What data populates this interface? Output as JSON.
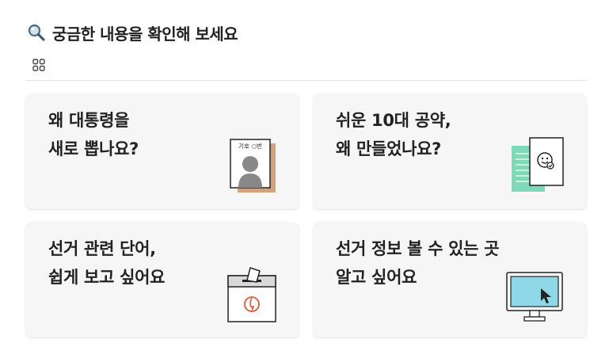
{
  "header": {
    "title": "궁금한 내용을 확인해 보세요",
    "icon": "magnifier-icon"
  },
  "view_toggle": {
    "icon": "grid-view-icon"
  },
  "cards": [
    {
      "line1": "왜 대통령을",
      "line2": "새로 뽑나요?",
      "illustration": "ballot-candidate-card-icon",
      "badge_text": "기호 ○번"
    },
    {
      "line1": "쉬운 10대 공약,",
      "line2": "왜 만들었나요?",
      "illustration": "document-smiley-icon"
    },
    {
      "line1": "선거 관련 단어,",
      "line2": "쉽게 보고 싶어요",
      "illustration": "ballot-box-icon"
    },
    {
      "line1": "선거 정보 볼 수 있는 곳",
      "line2": "알고 싶어요",
      "illustration": "monitor-cursor-icon"
    }
  ],
  "colors": {
    "card_bg": "#f6f6f6",
    "accent_tan": "#d4a27f",
    "accent_mint": "#7ed9b8",
    "screen_blue": "#8fd8e8",
    "stamp_red": "#e05a3a"
  }
}
